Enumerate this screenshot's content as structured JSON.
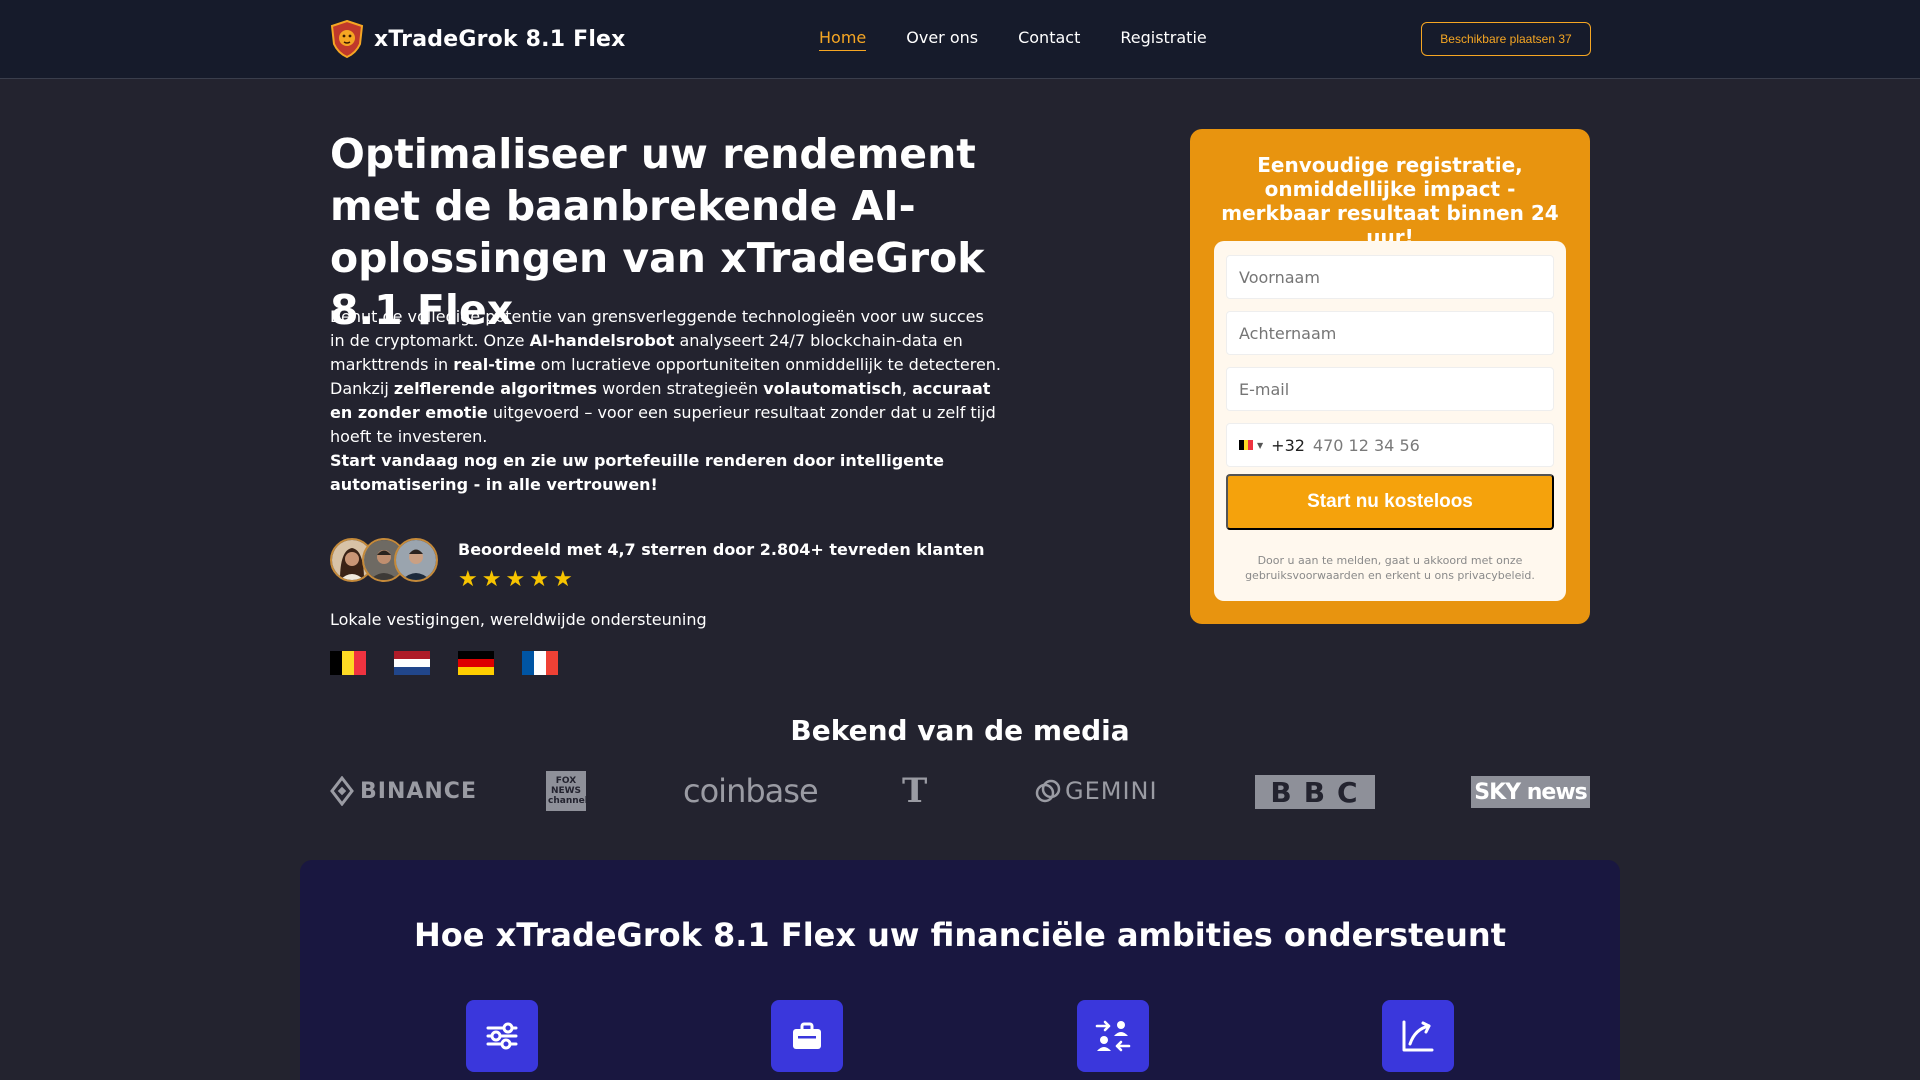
{
  "brand": {
    "name": "xTradeGrok 8.1 Flex"
  },
  "nav": {
    "items": [
      {
        "label": "Home",
        "active": true
      },
      {
        "label": "Over ons",
        "active": false
      },
      {
        "label": "Contact",
        "active": false
      },
      {
        "label": "Registratie",
        "active": false
      }
    ],
    "seats_button": "Beschikbare plaatsen 37"
  },
  "hero": {
    "title": "Optimaliseer uw rendement met de baanbrekende AI-oplossingen van xTradeGrok 8.1 Flex",
    "description": {
      "p1": "Benut de volledige potentie van grensverleggende technologieën voor uw succes in de cryptomarkt. Onze ",
      "b1": "AI-handelsrobot",
      "p2": " analyseert 24/7 blockchain-data en markttrends in ",
      "b2": "real-time",
      "p3": " om lucratieve opportuniteiten onmiddellijk te detecteren. Dankzij ",
      "b3": "zelflerende algoritmes",
      "p4": " worden strategieën ",
      "b4": "volautomatisch",
      "p5": ", ",
      "b5": "accuraat en zonder emotie",
      "p6": " uitgevoerd – voor een superieur resultaat zonder dat u zelf tijd hoeft te investeren."
    },
    "cta": "Start vandaag nog en zie uw portefeuille renderen door intelligente automatisering - in alle vertrouwen!",
    "rating_label": "Beoordeeld met 4,7 sterren door 2.804+ tevreden klanten",
    "stars": 5,
    "locations_label": "Lokale vestigingen, wereldwijde ondersteuning",
    "flags": [
      "belgium-flag",
      "netherlands-flag",
      "germany-flag",
      "france-flag"
    ]
  },
  "form": {
    "title": "Eenvoudige registratie, onmiddellijke impact - merkbaar resultaat binnen 24 uur!",
    "first_name_placeholder": "Voornaam",
    "last_name_placeholder": "Achternaam",
    "email_placeholder": "E-mail",
    "dial_code": "+32",
    "phone_placeholder": "470 12 34 56",
    "submit_label": "Start nu kosteloos",
    "disclaimer": "Door u aan te melden, gaat u akkoord met onze gebruiksvoorwaarden en erkent u ons privacybeleid."
  },
  "media": {
    "title": "Bekend van de media",
    "logos": [
      "BINANCE",
      "FOX NEWS channel",
      "coinbase",
      "T",
      "GEMINI",
      "BBC",
      "SKY news"
    ]
  },
  "features": {
    "title": "Hoe xTradeGrok 8.1 Flex uw financiële ambities ondersteunt",
    "icons": [
      "sliders-icon",
      "briefcase-icon",
      "transfer-users-icon",
      "growth-chart-icon"
    ]
  },
  "colors": {
    "background": "#23232f",
    "navbar": "#161b2b",
    "accent": "#f5a623",
    "form_card": "#e8940f",
    "features_bg": "#191740",
    "feature_icon_bg": "#3a37dc"
  }
}
